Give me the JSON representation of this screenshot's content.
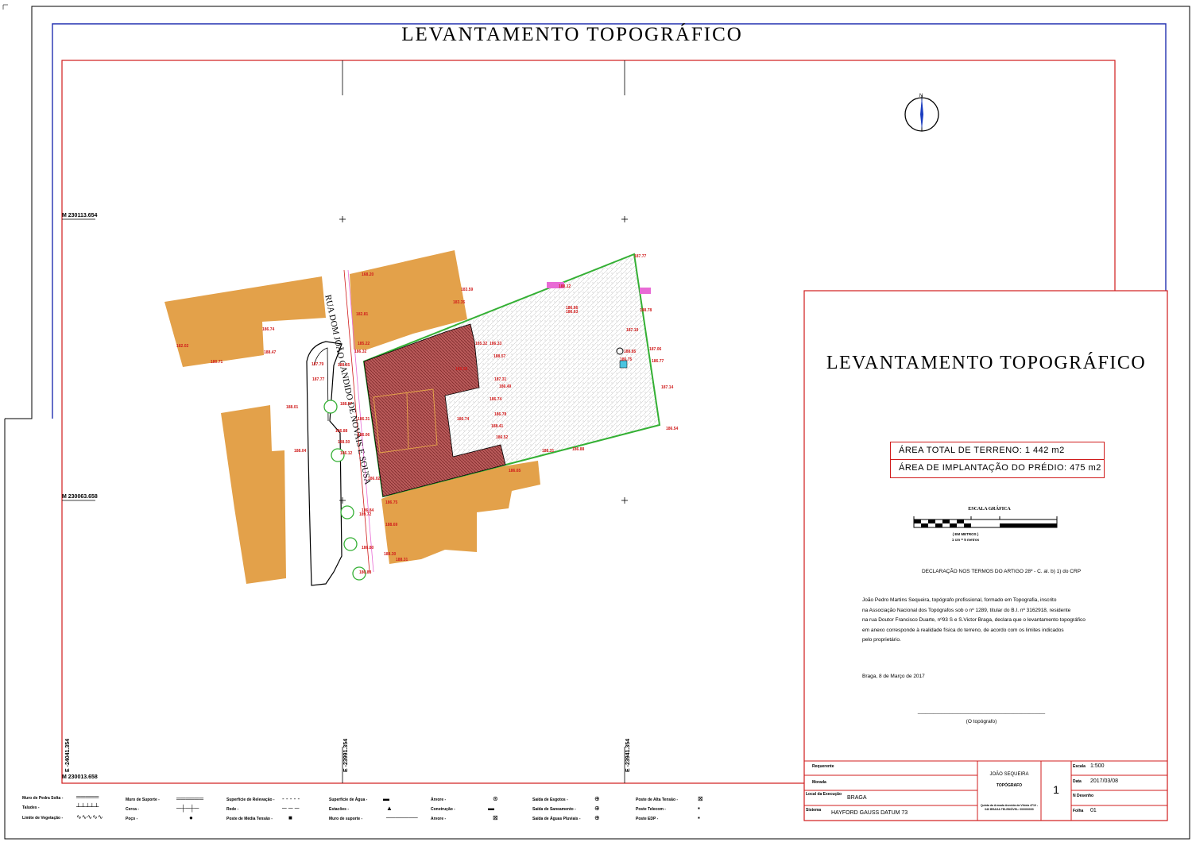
{
  "title": "LEVANTAMENTO TOPOGRÁFICO",
  "grid_coords": {
    "n1": "M 230113.654",
    "n2": "M 230063.658",
    "e1": "E -24041.354",
    "e2": "E -23991.354",
    "e3": "E -23941.354",
    "corner": "M 230013.658"
  },
  "street_name": "RUA DOM JOÃO CANDIDO DE NOVAIS E SOUSA",
  "elevations": [
    "182.02",
    "168.20",
    "183.59",
    "183.35",
    "186.74",
    "188.47",
    "180.71",
    "182.81",
    "186.32",
    "185.22",
    "187.79",
    "187.77",
    "188.65",
    "188.57",
    "188.01",
    "188.04",
    "186.31",
    "186.06",
    "186.88",
    "188.50",
    "186.12",
    "186.02",
    "189.72",
    "186.84",
    "186.75",
    "188.69",
    "186.80",
    "188.30",
    "186.88",
    "188.31",
    "188.12",
    "186.66",
    "187.77",
    "186.63",
    "188.78",
    "187.19",
    "188.85",
    "186.75",
    "187.06",
    "186.77",
    "187.14",
    "186.54",
    "186.88",
    "188.31",
    "186.65",
    "188.57",
    "187.31",
    "186.49",
    "186.74",
    "186.78",
    "188.41",
    "186.52",
    "186.74",
    "188.95",
    "185.32",
    "186.33"
  ],
  "panel": {
    "title": "LEVANTAMENTO TOPOGRÁFICO",
    "area_total": "ÁREA TOTAL DE TERRENO: 1 442 m2",
    "area_implantacao": "ÁREA DE IMPLANTAÇÃO DO PRÉDIO: 475 m2",
    "scale_title": "ESCALA GRÁFICA",
    "scale_sub1": "( EM METROS )",
    "scale_sub2": "1 cm = 5 metros",
    "declaration_title": "DECLARAÇÃO NOS TERMOS DO ARTIGO 28º - C. al. b) 1) do CRP",
    "declaration_lines": [
      "João Pedro Martins Sequeira, topógrafo profissional, formado em Topografia, inscrito",
      "na Associação Nacional dos Topógrafos sob o nº 1289, titular do B.I. nº 3162918, residente",
      "na rua Doutor Francisco Duarte, nº93 S e S.Victor Braga, declara que o levantamento topográfico",
      "em anexo corresponde à realidade física do terreno, de acordo com os limites indicados",
      "pelo proprietário."
    ],
    "place_date": "Braga, 8 de Março de 2017",
    "signature_line": "________________________________________________",
    "signature_label": "(O topógrafo)"
  },
  "titleblock": {
    "requerente_label": "Requerente",
    "morada_label": "Morada",
    "local_label": "Local da Execução",
    "local_value": "BRAGA",
    "sistema_label": "Sistema",
    "sistema_value": "HAYFORD GAUSS DATUM 73",
    "author_name": "JOÃO SEQUEIRA",
    "author_role": "TOPÓGRAFO",
    "author_address": "Quinta da Armada Avenida da Vitória 4710 - 040 BRAGA TELEMÓVEL: 000000000",
    "sheet_number": "1",
    "escala_label": "Escala",
    "escala_value": "1:500",
    "data_label": "Data",
    "data_value": "2017/03/08",
    "n_desenho_label": "N Desenho",
    "folha_label": "Folha",
    "folha_value": "01"
  },
  "legend": [
    {
      "label": "Muro de Pedra Solta -",
      "symbol": "═════"
    },
    {
      "label": "Taludes -",
      "symbol": "┴┴┴┴┴"
    },
    {
      "label": "Limite de Vegetação -",
      "symbol": "∿∿∿∿∿"
    },
    {
      "label": "Muro de Suporte -",
      "symbol": "══════"
    },
    {
      "label": "Cerca -",
      "symbol": "─┼─┼─"
    },
    {
      "label": "Poço -",
      "symbol": "●"
    },
    {
      "label": "Superfície de Relevação -",
      "symbol": "- - - - -"
    },
    {
      "label": "Rede -",
      "symbol": "─ ─ ─"
    },
    {
      "label": "Poste de Média Tensão -",
      "symbol": "■"
    },
    {
      "label": "Superfície de Água -",
      "symbol": "▬"
    },
    {
      "label": "Estacões -",
      "symbol": "▲"
    },
    {
      "label": "Muro de suporte -",
      "symbol": "───────"
    },
    {
      "label": "Árvore -",
      "symbol": "⊛"
    },
    {
      "label": "Construção -",
      "symbol": "▬"
    },
    {
      "label": "Arvore -",
      "symbol": "⊠"
    },
    {
      "label": "Saída de Esgotos -",
      "symbol": "⊕"
    },
    {
      "label": "Saída de Saneamento -",
      "symbol": "⊕"
    },
    {
      "label": "Saída de Águas Pluviais -",
      "symbol": "⊕"
    },
    {
      "label": "Poste de Alta Tensão -",
      "symbol": "⊠"
    },
    {
      "label": "Poste Telecom -",
      "symbol": "▪"
    },
    {
      "label": "Poste EDP -",
      "symbol": "▪"
    }
  ]
}
